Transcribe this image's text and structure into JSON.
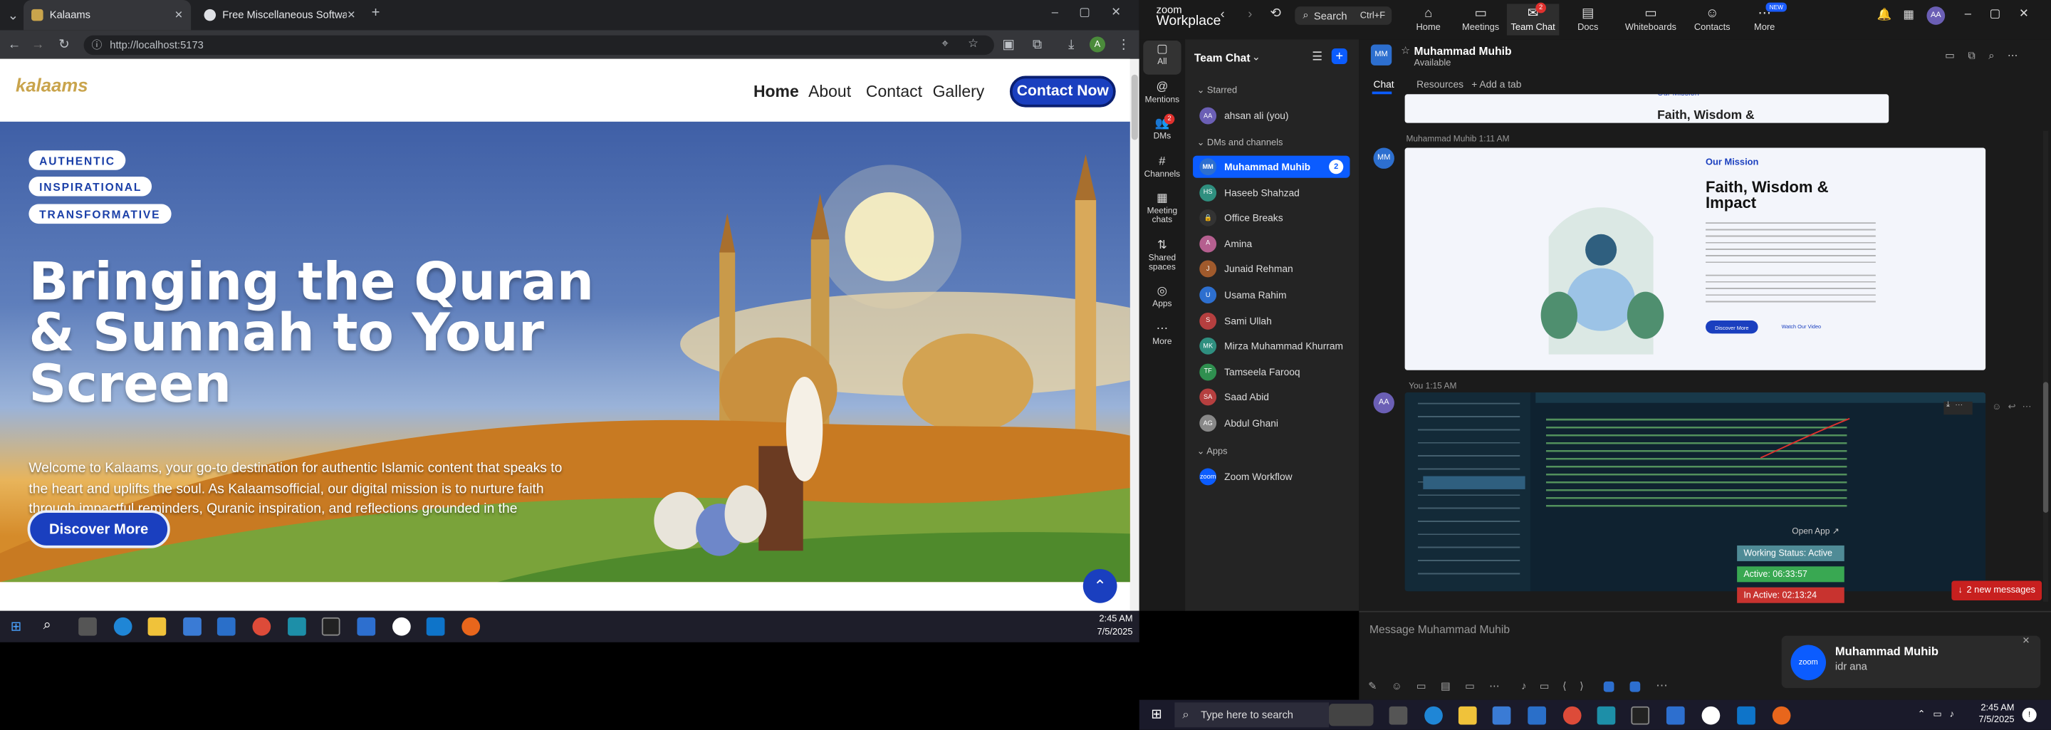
{
  "browser": {
    "tabs": [
      {
        "label": "Kalaams",
        "color": "#c9a44c"
      },
      {
        "label": "Free Miscellaneous Software - [",
        "color": "#dfe1e5"
      }
    ],
    "url": "http://localhost:5173"
  },
  "site": {
    "logo": "kalaams",
    "nav": [
      "Home",
      "About",
      "Contact",
      "Gallery"
    ],
    "nav_cta": "Contact Now",
    "pills": [
      "AUTHENTIC",
      "INSPIRATIONAL",
      "TRANSFORMATIVE"
    ],
    "title": "Bringing the Quran & Sunnah to Your Screen",
    "intro": "Welcome to Kalaams, your go-to destination for authentic Islamic content that speaks to the heart and uplifts the soul. As Kalaamsofficial, our digital mission is to nurture faith through impactful reminders, Quranic inspiration, and reflections grounded in the teachings of Islam.",
    "cta": "Discover More",
    "accent": "#1a3fbf"
  },
  "taskbar_left": {
    "time": "2:45 AM",
    "date": "7/5/2025"
  },
  "zoom": {
    "logo_top": "zoom",
    "logo_bottom": "Workplace",
    "search": "Search",
    "search_shortcut": "Ctrl+F",
    "top_tabs": [
      "Home",
      "Meetings",
      "Team Chat",
      "Docs",
      "Whiteboards",
      "Contacts",
      "More"
    ],
    "team_chat_badge": "2",
    "more_badge": "NEW",
    "rail": [
      "All",
      "Mentions",
      "DMs",
      "Channels",
      "Meeting chats",
      "Shared spaces",
      "Apps",
      "More"
    ],
    "dms_badge": "2",
    "list_title": "Team Chat",
    "sections": {
      "starred": "Starred",
      "dms": "DMs and channels",
      "apps": "Apps"
    },
    "starred": [
      {
        "name": "ahsan ali (you)",
        "initials": "AA",
        "color": "#6b5fb5"
      }
    ],
    "contacts": [
      {
        "name": "Muhammad Muhib",
        "initials": "MM",
        "color": "#2d6fcf",
        "badge": "2",
        "active": true
      },
      {
        "name": "Haseeb Shahzad",
        "initials": "HS",
        "color": "#2f8f7f"
      },
      {
        "name": "Office Breaks",
        "initials": "🔒",
        "color": "#333333"
      },
      {
        "name": "Amina",
        "initials": "A",
        "color": "#b55f8f"
      },
      {
        "name": "Junaid Rehman",
        "initials": "J",
        "color": "#a05a2c"
      },
      {
        "name": "Usama Rahim",
        "initials": "U",
        "color": "#2d6fcf"
      },
      {
        "name": "Sami Ullah",
        "initials": "S",
        "color": "#b53f3f"
      },
      {
        "name": "Mirza Muhammad Khurram",
        "initials": "MK",
        "color": "#2f8f7f"
      },
      {
        "name": "Tamseela Farooq",
        "initials": "TF",
        "color": "#2f8f4f"
      },
      {
        "name": "Saad Abid",
        "initials": "SA",
        "color": "#b53f3f"
      },
      {
        "name": "Abdul Ghani",
        "initials": "AG",
        "color": "#888888"
      }
    ],
    "apps": [
      {
        "name": "Zoom Workflow",
        "initials": "zoom",
        "color": "#0b5cff"
      }
    ],
    "chat": {
      "name": "Muhammad Muhib",
      "status": "Available",
      "tabs": [
        "Chat",
        "Resources",
        "+ Add a tab"
      ],
      "msg1_meta": "Muhammad Muhib 1:11 AM",
      "mission_label": "Our Mission",
      "mission_title": "Faith, Wisdom & Impact",
      "mission_btn1": "Discover More",
      "mission_btn2": "Watch Our Video",
      "msg2_meta": "You 1:15 AM",
      "open_app": "Open App ↗",
      "work_status": "Working Status: Active",
      "active": "Active: 06:33:57",
      "inactive": "In Active: 02:13:24",
      "new_messages": "2 new messages",
      "placeholder": "Message Muhammad Muhib"
    },
    "toast": {
      "name": "Muhammad Muhib",
      "message": "idr ana"
    }
  },
  "taskbar_right": {
    "search": "Type here to search",
    "time": "2:45 AM",
    "date": "7/5/2025"
  }
}
